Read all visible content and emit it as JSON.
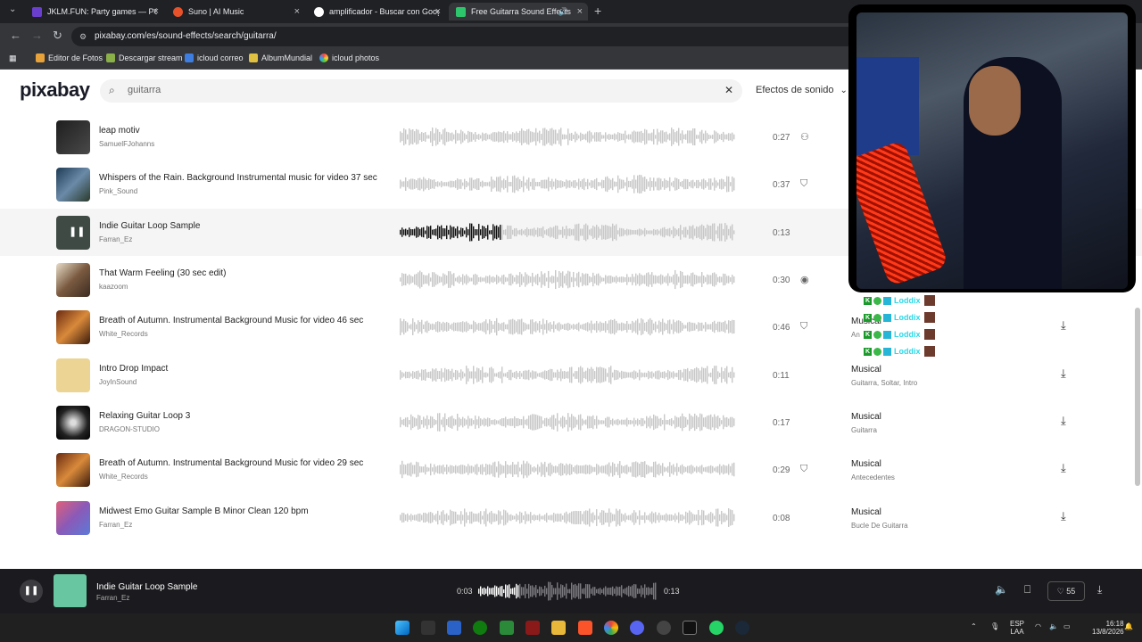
{
  "browser": {
    "tabs": [
      {
        "title": "JKLM.FUN: Party games — PC &",
        "active": false
      },
      {
        "title": "Suno | AI Music",
        "active": false
      },
      {
        "title": "amplificador - Buscar con Goog",
        "active": false
      },
      {
        "title": "Free Guitarra Sound Effects",
        "active": true
      }
    ],
    "url": "pixabay.com/es/sound-effects/search/guitarra/",
    "bookmarks": [
      "Editor de Fotos",
      "Descargar stream",
      "icloud correo",
      "AlbumMundial",
      "icloud photos"
    ]
  },
  "header": {
    "logo": "pixabay",
    "search_value": "guitarra",
    "category": "Efectos de sonido"
  },
  "results": [
    {
      "title": "leap motiv",
      "author": "SamuelFJohanns",
      "duration": "0:27",
      "category": "",
      "tags": ""
    },
    {
      "title": "Whispers of the Rain. Background Instrumental music for video 37 sec",
      "author": "Pink_Sound",
      "duration": "0:37",
      "category": "",
      "tags": ""
    },
    {
      "title": "Indie Guitar Loop Sample",
      "author": "Farran_Ez",
      "duration": "0:13",
      "category": "",
      "tags": "",
      "playing": true,
      "progress": 0.3
    },
    {
      "title": "That Warm Feeling (30 sec edit)",
      "author": "kaazoom",
      "duration": "0:30",
      "category": "",
      "tags": ""
    },
    {
      "title": "Breath of Autumn. Instrumental Background Music for video 46 sec",
      "author": "White_Records",
      "duration": "0:46",
      "category": "Musical",
      "tags": "An"
    },
    {
      "title": "Intro Drop Impact",
      "author": "JoyInSound",
      "duration": "0:11",
      "category": "Musical",
      "tags": "Guitarra, Soltar, Intro"
    },
    {
      "title": "Relaxing Guitar Loop 3",
      "author": "DRAGON-STUDIO",
      "duration": "0:17",
      "category": "Musical",
      "tags": "Guitarra"
    },
    {
      "title": "Breath of Autumn. Instrumental Background Music for video 29 sec",
      "author": "White_Records",
      "duration": "0:29",
      "category": "Musical",
      "tags": "Antecedentes"
    },
    {
      "title": "Midwest Emo Guitar Sample B Minor Clean 120 bpm",
      "author": "Farran_Ez",
      "duration": "0:08",
      "category": "Musical",
      "tags": "Bucle De Guitarra"
    }
  ],
  "player": {
    "title": "Indie Guitar Loop Sample",
    "author": "Farran_Ez",
    "current_time": "0:03",
    "total_time": "0:13",
    "progress": 0.23,
    "likes": "55"
  },
  "overlay": {
    "badge_name": "Loddix"
  },
  "taskbar": {
    "lang_top": "ESP",
    "lang_bottom": "LAA",
    "time": "16:18",
    "date": "13/8/2026"
  },
  "colors": {
    "tab_bar": "#202124",
    "toolbar": "#35363a",
    "player_bg": "#1b1b1f",
    "wave_played": "#111111",
    "wave_idle": "#c8c8c8"
  }
}
